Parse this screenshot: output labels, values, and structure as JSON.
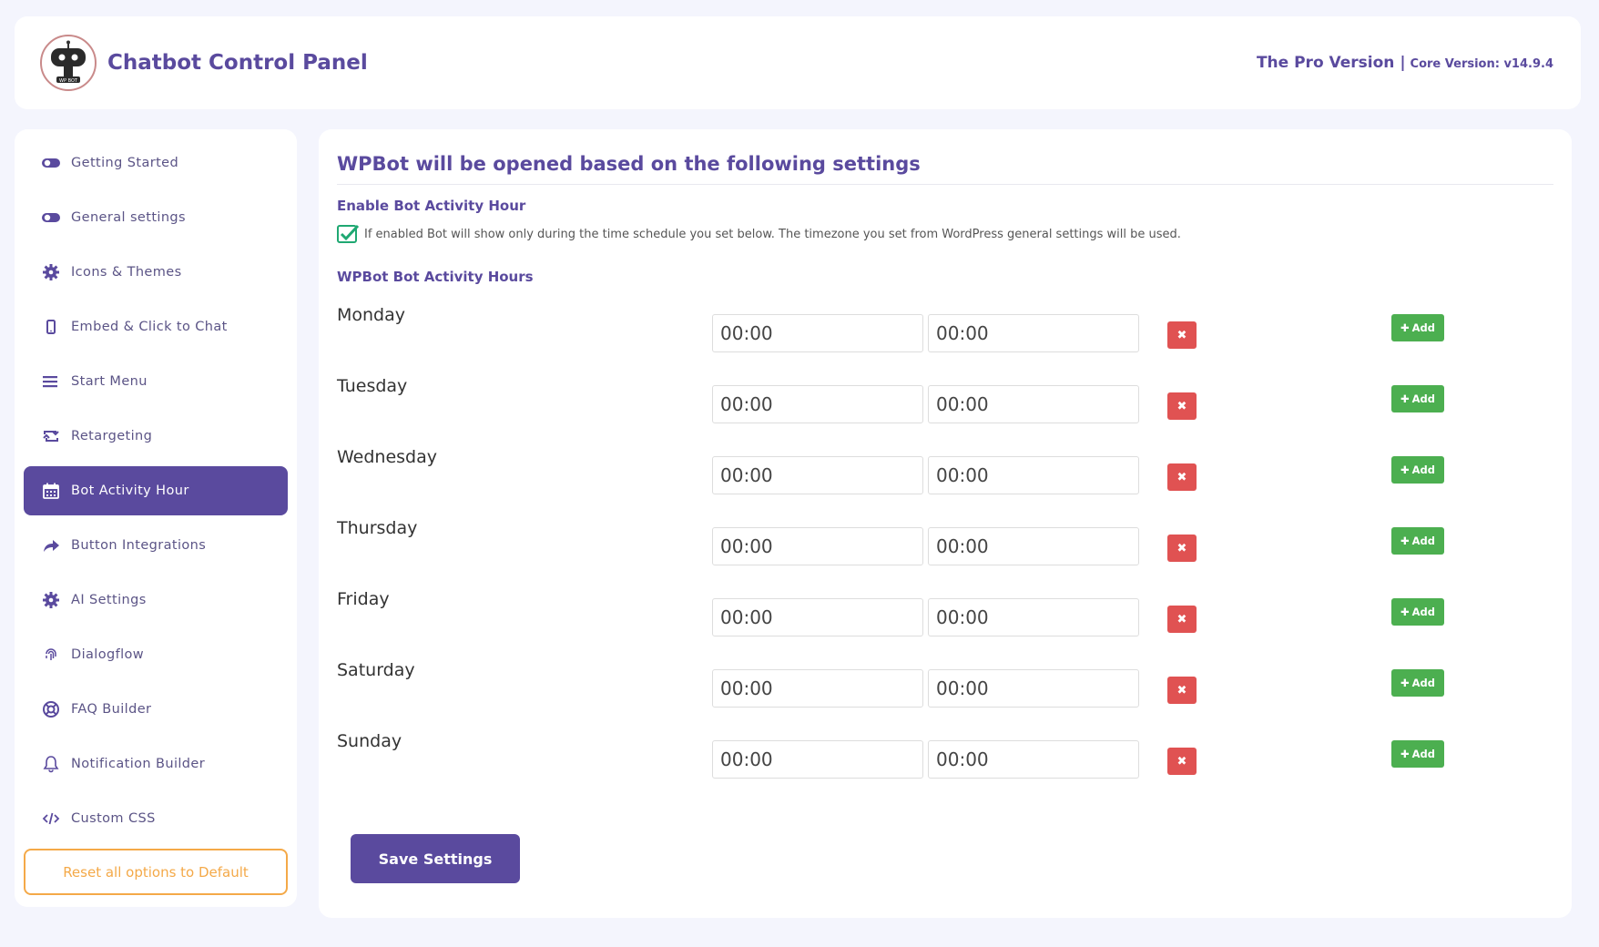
{
  "header": {
    "title": "Chatbot Control Panel",
    "pro_version": "The Pro Version |",
    "core_version": "Core Version: v14.9.4",
    "logo_text": "WP BOT"
  },
  "sidebar": {
    "items": [
      {
        "label": "Getting Started",
        "icon": "toggle-icon"
      },
      {
        "label": "General settings",
        "icon": "toggle-icon"
      },
      {
        "label": "Icons & Themes",
        "icon": "gear-icon"
      },
      {
        "label": "Embed & Click to Chat",
        "icon": "mobile-icon"
      },
      {
        "label": "Start Menu",
        "icon": "menu-icon"
      },
      {
        "label": "Retargeting",
        "icon": "retweet-icon"
      },
      {
        "label": "Bot Activity Hour",
        "icon": "calendar-icon",
        "active": true
      },
      {
        "label": "Button Integrations",
        "icon": "share-icon"
      },
      {
        "label": "AI Settings",
        "icon": "gear-icon"
      },
      {
        "label": "Dialogflow",
        "icon": "fingerprint-icon"
      },
      {
        "label": "FAQ Builder",
        "icon": "life-ring-icon"
      },
      {
        "label": "Notification Builder",
        "icon": "bell-icon"
      },
      {
        "label": "Custom CSS",
        "icon": "code-icon"
      }
    ],
    "reset_label": "Reset all options to Default"
  },
  "main": {
    "title": "WPBot will be opened based on the following settings",
    "enable_title": "Enable Bot Activity Hour",
    "enable_checked": true,
    "enable_description": "If enabled Bot will show only during the time schedule you set below. The timezone you set from WordPress general settings will be used.",
    "hours_title": "WPBot Bot Activity Hours",
    "days": [
      {
        "name": "Monday",
        "start": "00:00",
        "end": "00:00"
      },
      {
        "name": "Tuesday",
        "start": "00:00",
        "end": "00:00"
      },
      {
        "name": "Wednesday",
        "start": "00:00",
        "end": "00:00"
      },
      {
        "name": "Thursday",
        "start": "00:00",
        "end": "00:00"
      },
      {
        "name": "Friday",
        "start": "00:00",
        "end": "00:00"
      },
      {
        "name": "Saturday",
        "start": "00:00",
        "end": "00:00"
      },
      {
        "name": "Sunday",
        "start": "00:00",
        "end": "00:00"
      }
    ],
    "delete_label": "✖",
    "add_label": "Add",
    "save_label": "Save Settings"
  },
  "colors": {
    "accent": "#5a4a9e",
    "add": "#4caf50",
    "delete": "#e05252",
    "reset": "#f4a948",
    "check": "#1fa872"
  }
}
